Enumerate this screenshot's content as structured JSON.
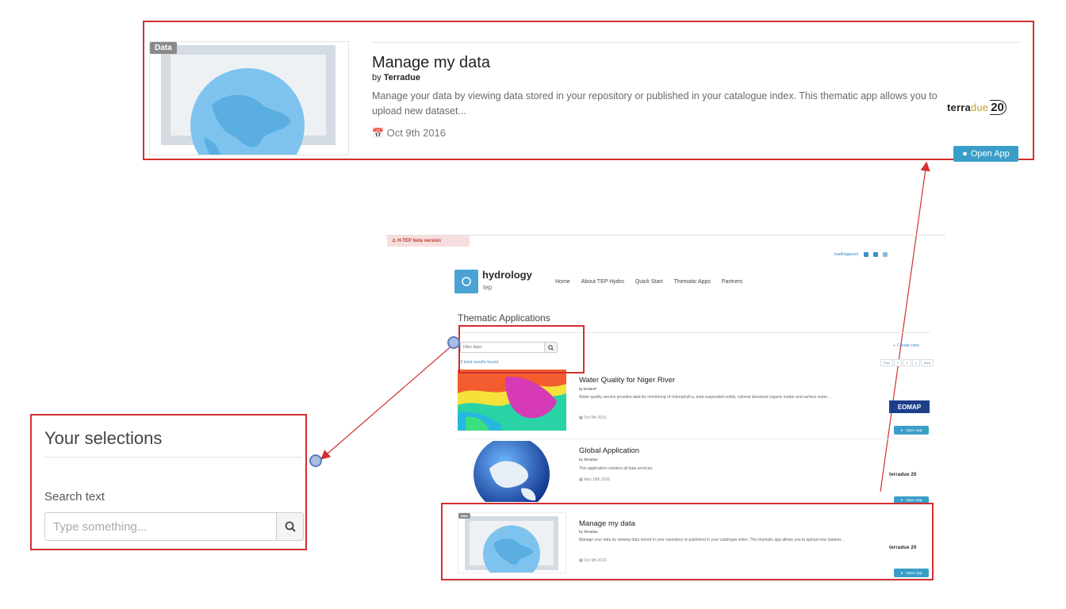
{
  "zoom_card": {
    "tag": "Data",
    "title": "Manage my data",
    "by_prefix": "by",
    "author": "Terradue",
    "description": "Manage your data by viewing data stored in your repository or published in your catalogue index. This thematic app allows you to upload new dataset...",
    "date": "Oct 9th 2016",
    "logo_text_a": "terra",
    "logo_text_b": "due",
    "logo_number": "20",
    "open_label": "Open App"
  },
  "selections": {
    "title": "Your selections",
    "search_label": "Search text",
    "search_placeholder": "Type something..."
  },
  "mini": {
    "beta_banner": "⚠ H-TEP beta version",
    "top_link": "lwalthagasser",
    "logo_word": "hydrology",
    "logo_sub": "tep",
    "nav": [
      "Home",
      "About TEP Hydro",
      "Quick Start",
      "Thematic Apps",
      "Partners"
    ],
    "page_title": "Thematic Applications",
    "filter_placeholder": "Filter Apps",
    "results_text": "3 total results found.",
    "create_new": "+ Create new",
    "pager": [
      "Prev",
      "1",
      "2",
      "3",
      "Next"
    ],
    "apps": [
      {
        "title": "Water Quality for Niger River",
        "by": "by EOMAP",
        "description": "Water quality service provides data for monitoring of chlorophyll-a, total suspended solids, colored dissolved organic matter and surface water...",
        "date": "Oct 9th 2016",
        "logo": "EOMAP",
        "open_label": "Open App"
      },
      {
        "title": "Global Application",
        "by": "by Terradue",
        "description": "This application contains all data services.",
        "date": "May 18th 2015",
        "logo": "terradue 20",
        "open_label": "Open App"
      },
      {
        "title": "Manage my data",
        "by": "by Terradue",
        "tag": "Data",
        "description": "Manage your data by viewing data stored in your repository or published in your catalogue index. This thematic app allows you to upload new dataset...",
        "date": "Oct 9th 2016",
        "logo": "terradue 20",
        "open_label": "Open App"
      }
    ]
  },
  "colors": {
    "highlight": "#d32f2f",
    "accent": "#3a9fc8",
    "marker": "#a9bde4"
  }
}
